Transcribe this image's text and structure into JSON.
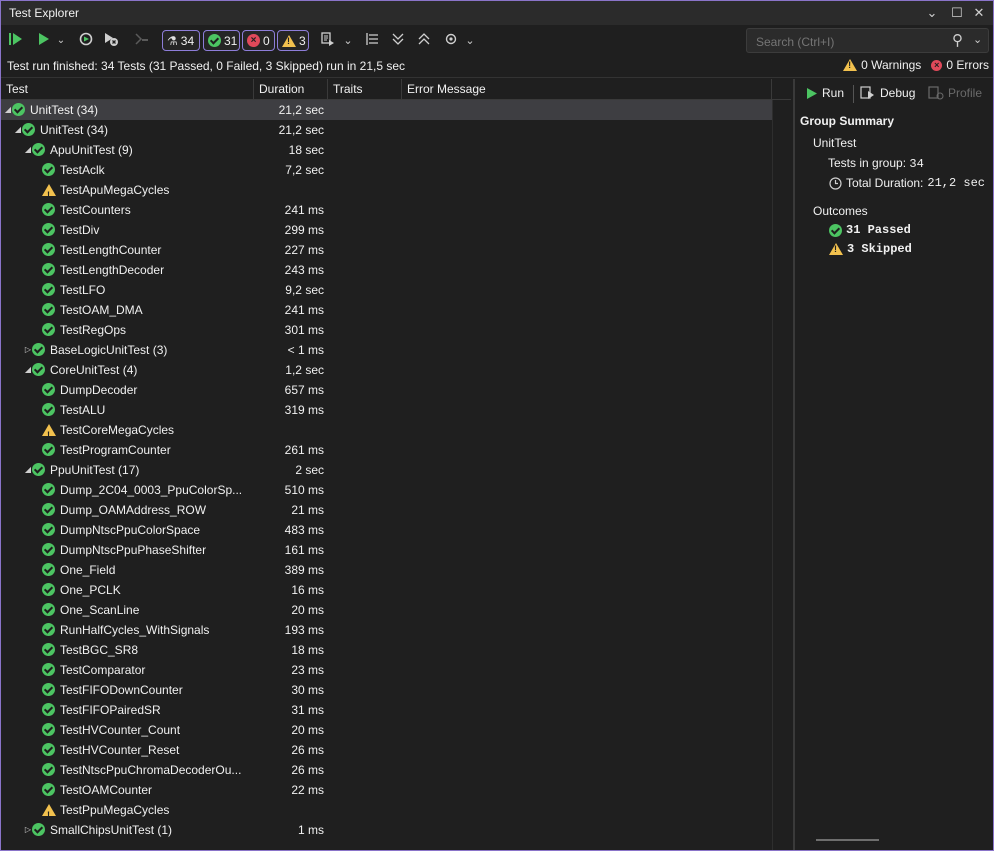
{
  "window": {
    "title": "Test Explorer"
  },
  "toolbar": {
    "total_count": "34",
    "passed_count": "31",
    "failed_count": "0",
    "skipped_count": "3",
    "search_placeholder": "Search (Ctrl+I)"
  },
  "status": {
    "summary": "Test run finished: 34 Tests (31 Passed, 0 Failed, 3 Skipped) run in 21,5 sec",
    "warnings": "0 Warnings",
    "errors": "0 Errors"
  },
  "grid": {
    "columns": [
      "Test",
      "Duration",
      "Traits",
      "Error Message"
    ],
    "rows": [
      {
        "name": "UnitTest (34)",
        "duration": "21,2 sec",
        "level": 0,
        "expand": "open",
        "status": "pass",
        "selected": true
      },
      {
        "name": "UnitTest (34)",
        "duration": "21,2 sec",
        "level": 1,
        "expand": "open",
        "status": "pass"
      },
      {
        "name": "ApuUnitTest (9)",
        "duration": "18 sec",
        "level": 2,
        "expand": "open",
        "status": "pass"
      },
      {
        "name": "TestAclk",
        "duration": "7,2 sec",
        "level": 3,
        "expand": "none",
        "status": "pass"
      },
      {
        "name": "TestApuMegaCycles",
        "duration": "",
        "level": 3,
        "expand": "none",
        "status": "warn"
      },
      {
        "name": "TestCounters",
        "duration": "241 ms",
        "level": 3,
        "expand": "none",
        "status": "pass"
      },
      {
        "name": "TestDiv",
        "duration": "299 ms",
        "level": 3,
        "expand": "none",
        "status": "pass"
      },
      {
        "name": "TestLengthCounter",
        "duration": "227 ms",
        "level": 3,
        "expand": "none",
        "status": "pass"
      },
      {
        "name": "TestLengthDecoder",
        "duration": "243 ms",
        "level": 3,
        "expand": "none",
        "status": "pass"
      },
      {
        "name": "TestLFO",
        "duration": "9,2 sec",
        "level": 3,
        "expand": "none",
        "status": "pass"
      },
      {
        "name": "TestOAM_DMA",
        "duration": "241 ms",
        "level": 3,
        "expand": "none",
        "status": "pass"
      },
      {
        "name": "TestRegOps",
        "duration": "301 ms",
        "level": 3,
        "expand": "none",
        "status": "pass"
      },
      {
        "name": "BaseLogicUnitTest (3)",
        "duration": "< 1 ms",
        "level": 2,
        "expand": "closed",
        "status": "pass"
      },
      {
        "name": "CoreUnitTest (4)",
        "duration": "1,2 sec",
        "level": 2,
        "expand": "open",
        "status": "pass"
      },
      {
        "name": "DumpDecoder",
        "duration": "657 ms",
        "level": 3,
        "expand": "none",
        "status": "pass"
      },
      {
        "name": "TestALU",
        "duration": "319 ms",
        "level": 3,
        "expand": "none",
        "status": "pass"
      },
      {
        "name": "TestCoreMegaCycles",
        "duration": "",
        "level": 3,
        "expand": "none",
        "status": "warn"
      },
      {
        "name": "TestProgramCounter",
        "duration": "261 ms",
        "level": 3,
        "expand": "none",
        "status": "pass"
      },
      {
        "name": "PpuUnitTest (17)",
        "duration": "2 sec",
        "level": 2,
        "expand": "open",
        "status": "pass"
      },
      {
        "name": "Dump_2C04_0003_PpuColorSp...",
        "duration": "510 ms",
        "level": 3,
        "expand": "none",
        "status": "pass"
      },
      {
        "name": "Dump_OAMAddress_ROW",
        "duration": "21 ms",
        "level": 3,
        "expand": "none",
        "status": "pass"
      },
      {
        "name": "DumpNtscPpuColorSpace",
        "duration": "483 ms",
        "level": 3,
        "expand": "none",
        "status": "pass"
      },
      {
        "name": "DumpNtscPpuPhaseShifter",
        "duration": "161 ms",
        "level": 3,
        "expand": "none",
        "status": "pass"
      },
      {
        "name": "One_Field",
        "duration": "389 ms",
        "level": 3,
        "expand": "none",
        "status": "pass"
      },
      {
        "name": "One_PCLK",
        "duration": "16 ms",
        "level": 3,
        "expand": "none",
        "status": "pass"
      },
      {
        "name": "One_ScanLine",
        "duration": "20 ms",
        "level": 3,
        "expand": "none",
        "status": "pass"
      },
      {
        "name": "RunHalfCycles_WithSignals",
        "duration": "193 ms",
        "level": 3,
        "expand": "none",
        "status": "pass"
      },
      {
        "name": "TestBGC_SR8",
        "duration": "18 ms",
        "level": 3,
        "expand": "none",
        "status": "pass"
      },
      {
        "name": "TestComparator",
        "duration": "23 ms",
        "level": 3,
        "expand": "none",
        "status": "pass"
      },
      {
        "name": "TestFIFODownCounter",
        "duration": "30 ms",
        "level": 3,
        "expand": "none",
        "status": "pass"
      },
      {
        "name": "TestFIFOPairedSR",
        "duration": "31 ms",
        "level": 3,
        "expand": "none",
        "status": "pass"
      },
      {
        "name": "TestHVCounter_Count",
        "duration": "20 ms",
        "level": 3,
        "expand": "none",
        "status": "pass"
      },
      {
        "name": "TestHVCounter_Reset",
        "duration": "26 ms",
        "level": 3,
        "expand": "none",
        "status": "pass"
      },
      {
        "name": "TestNtscPpuChromaDecoderOu...",
        "duration": "26 ms",
        "level": 3,
        "expand": "none",
        "status": "pass"
      },
      {
        "name": "TestOAMCounter",
        "duration": "22 ms",
        "level": 3,
        "expand": "none",
        "status": "pass"
      },
      {
        "name": "TestPpuMegaCycles",
        "duration": "",
        "level": 3,
        "expand": "none",
        "status": "warn"
      },
      {
        "name": "SmallChipsUnitTest (1)",
        "duration": "1 ms",
        "level": 2,
        "expand": "closed",
        "status": "pass"
      }
    ]
  },
  "detail": {
    "run_label": "Run",
    "debug_label": "Debug",
    "profile_label": "Profile",
    "group_summary_title": "Group Summary",
    "group_name": "UnitTest",
    "tests_in_group_label": "Tests in group:",
    "tests_in_group_value": "34",
    "total_duration_label": "Total Duration:",
    "total_duration_value": "21,2 sec",
    "outcomes_title": "Outcomes",
    "passed_label": "31 Passed",
    "skipped_label": "3 Skipped"
  },
  "colors": {
    "accent_border": "#8d7dd8",
    "pass": "#4cc462",
    "fail": "#e0495a",
    "warn": "#f2c14e",
    "run_green": "#4cc462"
  }
}
